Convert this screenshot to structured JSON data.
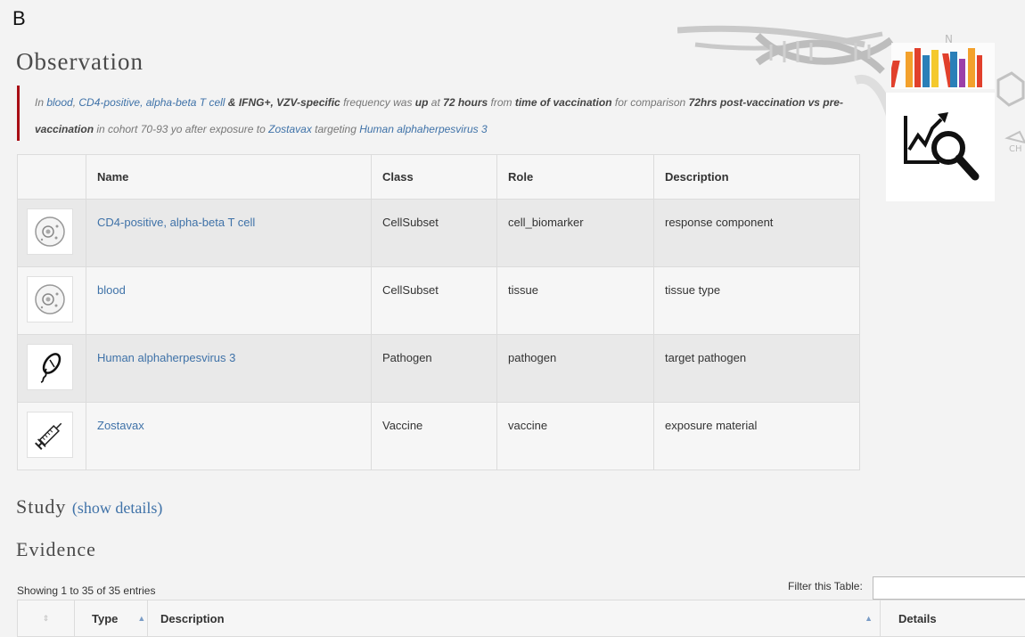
{
  "panel_label": "B",
  "observation": {
    "title": "Observation",
    "statement": {
      "s1": "In ",
      "tissue": "blood",
      "s2": ", ",
      "cell": "CD4-positive, alpha-beta T cell",
      "s3": " & ",
      "marker": "IFNG+, VZV-specific",
      "s4": " frequency was ",
      "direction": "up",
      "s5": " at ",
      "time": "72 hours",
      "s6": " from ",
      "ref_event": "time of vaccination",
      "s7": " for comparison ",
      "comparison": "72hrs post-vaccination vs pre-vaccination",
      "s8": " in cohort 70-93 yo after exposure to ",
      "vaccine": "Zostavax",
      "s9": " targeting ",
      "pathogen": "Human alphaherpesvirus 3"
    }
  },
  "components": {
    "headers": [
      "",
      "Name",
      "Class",
      "Role",
      "Description"
    ],
    "rows": [
      {
        "icon": "cell-icon",
        "name": "CD4-positive, alpha-beta T cell",
        "class": "CellSubset",
        "role": "cell_biomarker",
        "description": "response component"
      },
      {
        "icon": "cell-icon",
        "name": "blood",
        "class": "CellSubset",
        "role": "tissue",
        "description": "tissue type"
      },
      {
        "icon": "pathogen-icon",
        "name": "Human alphaherpesvirus 3",
        "class": "Pathogen",
        "role": "pathogen",
        "description": "target pathogen"
      },
      {
        "icon": "syringe-icon",
        "name": "Zostavax",
        "class": "Vaccine",
        "role": "vaccine",
        "description": "exposure material"
      }
    ]
  },
  "study": {
    "title": "Study",
    "link_label": "(show details)"
  },
  "evidence": {
    "title": "Evidence",
    "showing": "Showing 1 to 35 of 35 entries",
    "filter_label": "Filter this Table:",
    "filter_value": "",
    "columns": {
      "type": "Type",
      "description": "Description",
      "details": "Details"
    }
  },
  "icons": [
    "dna-helix-icon",
    "books-icon",
    "analysis-magnifier-icon"
  ],
  "colors": {
    "accent_bar": "#a80d14",
    "link": "#3f72a8",
    "page_bg": "#f3f3f3"
  }
}
